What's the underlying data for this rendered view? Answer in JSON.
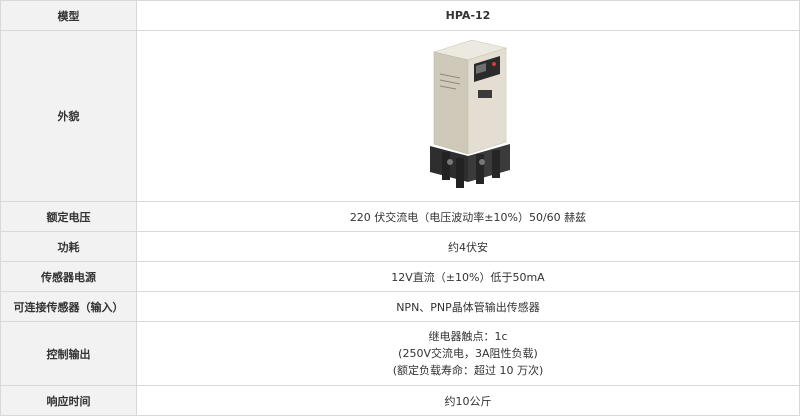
{
  "table": {
    "rows": [
      {
        "label": "模型",
        "value": "HPA-12"
      },
      {
        "label": "外貌",
        "image": "relay-product-image"
      },
      {
        "label": "额定电压",
        "value": "220 伏交流电（电压波动率±10%）50/60 赫兹"
      },
      {
        "label": "功耗",
        "value": "约4伏安"
      },
      {
        "label": "传感器电源",
        "value": "12V直流（±10%）低于50mA"
      },
      {
        "label": "可连接传感器（输入）",
        "value": "NPN、PNP晶体管输出传感器"
      },
      {
        "label": "控制输出",
        "lines": [
          "继电器触点：1c",
          "(250V交流电，3A阻性负载)",
          "(额定负载寿命：超过 10 万次)"
        ]
      },
      {
        "label": "响应时间",
        "value": "约10公斤"
      }
    ]
  },
  "colors": {
    "label_bg": "#f2f2f2",
    "border": "#d9d9d9",
    "text": "#333333"
  }
}
